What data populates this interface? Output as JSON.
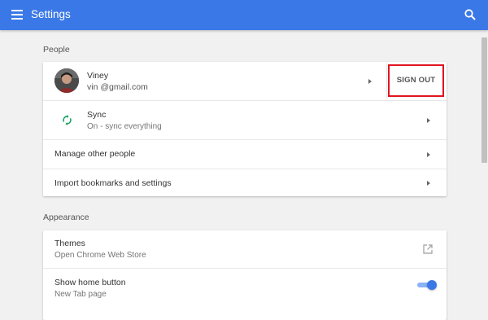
{
  "header": {
    "title": "Settings",
    "menu_icon": "menu-icon",
    "search_icon": "search-icon",
    "color": "#3b78e7"
  },
  "people": {
    "section_title": "People",
    "account": {
      "name": "Viney",
      "email": "vin               @gmail.com",
      "sign_out_label": "SIGN OUT"
    },
    "sync": {
      "title": "Sync",
      "subtitle": "On - sync everything",
      "icon": "sync-icon"
    },
    "manage_people": "Manage other people",
    "import_bookmarks": "Import bookmarks and settings"
  },
  "appearance": {
    "section_title": "Appearance",
    "themes": {
      "title": "Themes",
      "subtitle": "Open Chrome Web Store",
      "icon": "open-in-new-icon"
    },
    "home_button": {
      "title": "Show home button",
      "subtitle": "New Tab page",
      "enabled": true
    }
  },
  "colors": {
    "accent": "#3b78e7",
    "highlight": "#e0141e",
    "sync_green": "#0f9d58"
  }
}
